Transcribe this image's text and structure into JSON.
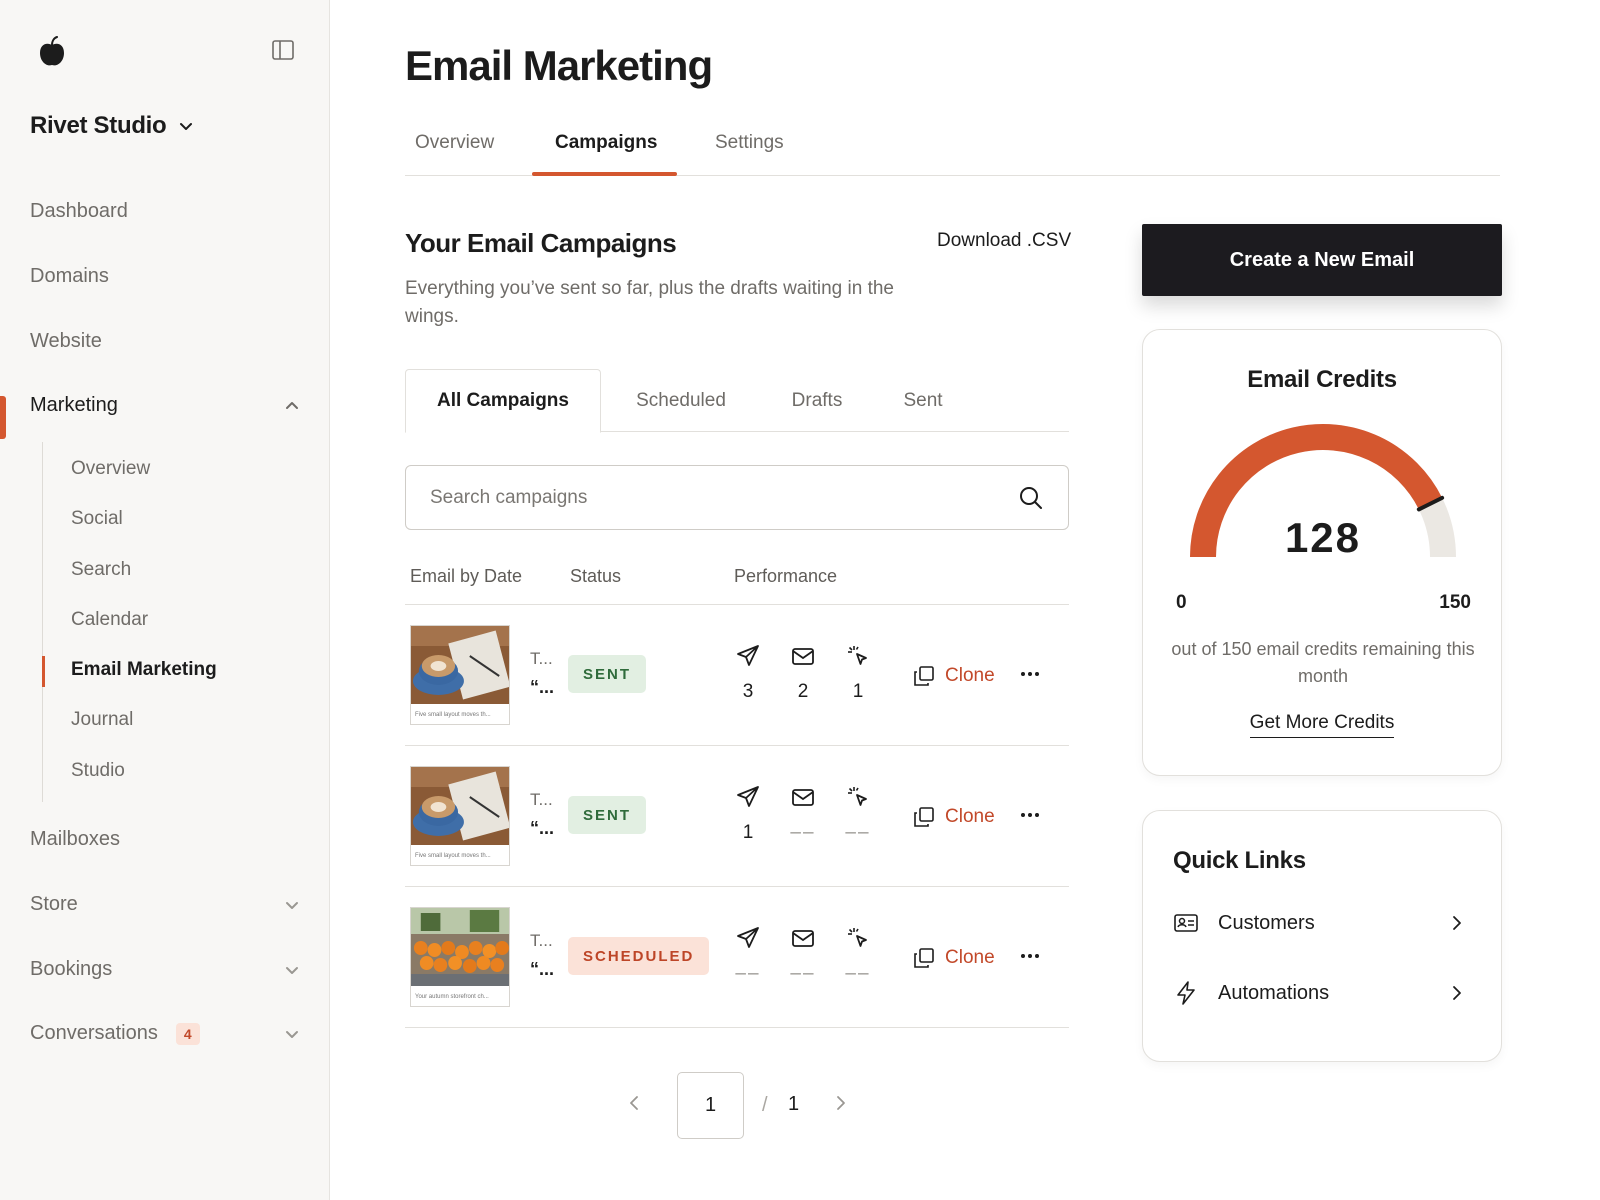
{
  "sidebar": {
    "workspace": "Rivet Studio",
    "items": [
      {
        "label": "Dashboard"
      },
      {
        "label": "Domains"
      },
      {
        "label": "Website"
      },
      {
        "label": "Marketing"
      },
      {
        "label": "Mailboxes"
      },
      {
        "label": "Store"
      },
      {
        "label": "Bookings"
      },
      {
        "label": "Conversations",
        "badge": "4"
      }
    ],
    "marketing_sub": [
      {
        "label": "Overview"
      },
      {
        "label": "Social"
      },
      {
        "label": "Search"
      },
      {
        "label": "Calendar"
      },
      {
        "label": "Email Marketing"
      },
      {
        "label": "Journal"
      },
      {
        "label": "Studio"
      }
    ],
    "active_item": "Marketing",
    "active_sub": "Email Marketing",
    "accent_color": "#d4572f"
  },
  "header": {
    "title": "Email Marketing",
    "tabs": [
      {
        "label": "Overview"
      },
      {
        "label": "Campaigns"
      },
      {
        "label": "Settings"
      }
    ],
    "active_tab": "Campaigns"
  },
  "campaigns": {
    "title": "Your Email Campaigns",
    "subtitle": "Everything you’ve sent so far, plus the drafts waiting in the wings.",
    "download_label": "Download .CSV",
    "filter_tabs": [
      {
        "label": "All Campaigns"
      },
      {
        "label": "Scheduled"
      },
      {
        "label": "Drafts"
      },
      {
        "label": "Sent"
      }
    ],
    "active_filter": "All Campaigns",
    "search_placeholder": "Search campaigns",
    "columns": {
      "date": "Email by Date",
      "status": "Status",
      "performance": "Performance"
    },
    "clone_label": "Clone",
    "rows": [
      {
        "title": "T...",
        "quote": "“...",
        "thumb_caption": "Five small layout moves th...",
        "status": "SENT",
        "status_kind": "sent",
        "sent": "3",
        "opened": "2",
        "clicked": "1"
      },
      {
        "title": "T...",
        "quote": "“...",
        "thumb_caption": "Five small layout moves th...",
        "status": "SENT",
        "status_kind": "sent",
        "sent": "1",
        "opened": "––",
        "clicked": "––"
      },
      {
        "title": "T...",
        "quote": "“...",
        "thumb_caption": "Your autumn storefront ch...",
        "status": "SCHEDULED",
        "status_kind": "scheduled",
        "sent": "––",
        "opened": "––",
        "clicked": "––"
      }
    ],
    "pagination": {
      "current": "1",
      "separator": "/",
      "total": "1"
    }
  },
  "cta": {
    "label": "Create a New Email"
  },
  "credits": {
    "title": "Email Credits",
    "remaining": 128,
    "max": 150,
    "min_label": "0",
    "max_label": "150",
    "value_label": "128",
    "description": "out of 150 email credits remaining this month",
    "link_label": "Get More Credits",
    "gauge_color": "#d4572f",
    "gauge_track_color": "#ebe8e3"
  },
  "quick_links": {
    "title": "Quick Links",
    "items": [
      {
        "label": "Customers",
        "icon": "contact-card-icon"
      },
      {
        "label": "Automations",
        "icon": "lightning-icon"
      }
    ]
  }
}
